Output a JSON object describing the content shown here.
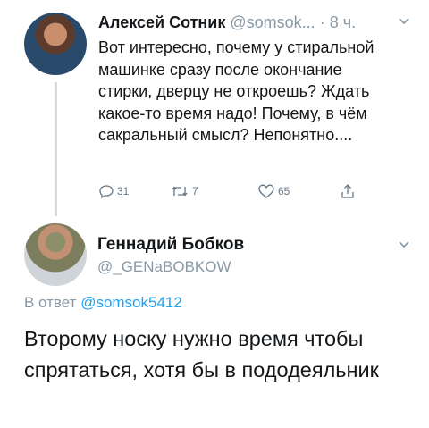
{
  "tweet": {
    "author_name": "Алексей Сотник",
    "author_handle": "@somsok...",
    "separator": "·",
    "time": "8 ч.",
    "text": "Вот интересно, почему у стиральной машинке сразу после окончание стирки, дверцу не откроешь? Ждать какое-то время надо! Почему, в чём сакральный смысл? Непонятно....",
    "reply_count": "31",
    "retweet_count": "7",
    "like_count": "65",
    "icons": [
      "reply-icon",
      "retweet-icon",
      "like-icon",
      "share-icon",
      "chevron-down-icon"
    ]
  },
  "reply": {
    "author_name": "Геннадий Бобков",
    "author_handle": "@_GENaBOBKOW",
    "reply_prefix": "В ответ",
    "reply_target": "@somsok5412",
    "text": "Второму носку нужно время чтобы спрятаться, хотя бы в пододеяльник"
  },
  "colors": {
    "text": "#14171a",
    "muted": "#8899a6",
    "link": "#1da1f2",
    "thread_line": "#d6dbdf"
  }
}
